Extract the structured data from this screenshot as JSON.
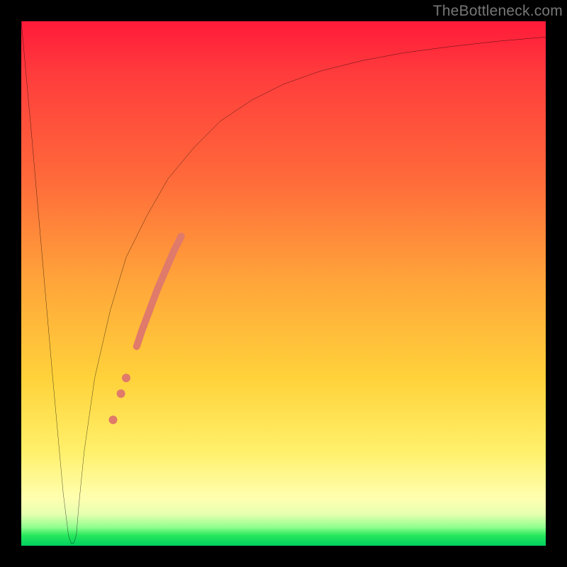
{
  "watermark": "TheBottleneck.com",
  "chart_data": {
    "type": "line",
    "title": "",
    "xlabel": "",
    "ylabel": "",
    "xlim": [
      0,
      100
    ],
    "ylim": [
      0,
      100
    ],
    "grid": false,
    "legend": false,
    "background_gradient": {
      "stops": [
        {
          "pct": 0,
          "color": "#ff1a3a"
        },
        {
          "pct": 30,
          "color": "#ff6a3a"
        },
        {
          "pct": 50,
          "color": "#ffa63a"
        },
        {
          "pct": 70,
          "color": "#ffd23a"
        },
        {
          "pct": 90,
          "color": "#ffffb0"
        },
        {
          "pct": 97,
          "color": "#8fff8f"
        },
        {
          "pct": 100,
          "color": "#00d060"
        }
      ]
    },
    "series": [
      {
        "name": "bottleneck-curve",
        "color": "#000000",
        "stroke_width": 2,
        "x": [
          0,
          2,
          4,
          6,
          8,
          9,
          9.5,
          10,
          10.5,
          11,
          12,
          14,
          17,
          20,
          24,
          28,
          33,
          38,
          44,
          50,
          57,
          65,
          73,
          82,
          91,
          100
        ],
        "y": [
          100,
          78,
          55,
          32,
          10,
          2,
          0.5,
          0.5,
          2,
          8,
          18,
          32,
          45,
          55,
          63,
          70,
          76,
          81,
          85,
          88,
          90.5,
          92.5,
          94,
          95.2,
          96.2,
          97
        ]
      }
    ],
    "highlight_segment": {
      "name": "thick-salmon-band",
      "color": "#e07a6a",
      "stroke_width": 10,
      "x": [
        22,
        23,
        24.5,
        26,
        27.5,
        29,
        30.5
      ],
      "y": [
        38,
        41,
        45,
        49,
        52.5,
        56,
        59
      ]
    },
    "highlight_dots": {
      "name": "salmon-dots",
      "color": "#e07a6a",
      "radius": 6,
      "points": [
        {
          "x": 20,
          "y": 32
        },
        {
          "x": 19,
          "y": 29
        },
        {
          "x": 17.5,
          "y": 24
        }
      ]
    }
  }
}
